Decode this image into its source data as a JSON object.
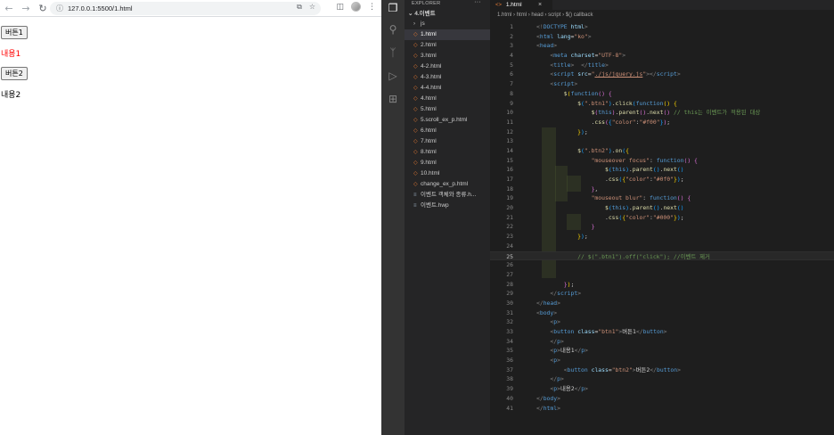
{
  "browser": {
    "url": "127.0.0.1:5500/1.html",
    "page": {
      "button1_label": "버튼1",
      "text1": "내용1",
      "button2_label": "버튼2",
      "text2": "내용2"
    },
    "colors": {
      "text1": "#ff0000",
      "text2": "#000000"
    }
  },
  "vscode": {
    "sidebar": {
      "header": "EXPLORER",
      "more": "···",
      "folder": "4.이벤트",
      "items": [
        {
          "label": "js",
          "type": "folder"
        },
        {
          "label": "1.html",
          "type": "html",
          "selected": true
        },
        {
          "label": "2.html",
          "type": "html"
        },
        {
          "label": "3.html",
          "type": "html"
        },
        {
          "label": "4-2.html",
          "type": "html"
        },
        {
          "label": "4-3.html",
          "type": "html"
        },
        {
          "label": "4-4.html",
          "type": "html"
        },
        {
          "label": "4.html",
          "type": "html"
        },
        {
          "label": "5.html",
          "type": "html"
        },
        {
          "label": "5.scroll_ex_p.html",
          "type": "html"
        },
        {
          "label": "6.html",
          "type": "html"
        },
        {
          "label": "7.html",
          "type": "html"
        },
        {
          "label": "8.html",
          "type": "html"
        },
        {
          "label": "9.html",
          "type": "html"
        },
        {
          "label": "10.html",
          "type": "html"
        },
        {
          "label": "change_ex_p.html",
          "type": "html"
        },
        {
          "label": "이벤트 객체와 종류.h...",
          "type": "doc"
        },
        {
          "label": "이벤트.hwp",
          "type": "doc"
        }
      ]
    },
    "tab": {
      "label": "1.html",
      "close": "×"
    },
    "breadcrumb": [
      "1.html",
      "html",
      "head",
      "script",
      "$() callback"
    ],
    "code_lines": [
      {
        "n": "1",
        "html": "<span class='t-punc'>&lt;!</span><span class='t-tag'>DOCTYPE</span> <span class='t-attr'>html</span><span class='t-punc'>&gt;</span>"
      },
      {
        "n": "2",
        "html": "<span class='t-punc'>&lt;</span><span class='t-tag'>html</span> <span class='t-attr'>lang</span>=<span class='t-str'>\"ko\"</span><span class='t-punc'>&gt;</span>"
      },
      {
        "n": "3",
        "html": "<span class='t-punc'>&lt;</span><span class='t-tag'>head</span><span class='t-punc'>&gt;</span>"
      },
      {
        "n": "4",
        "html": "    <span class='t-punc'>&lt;</span><span class='t-tag'>meta</span> <span class='t-attr'>charset</span>=<span class='t-str'>\"UTF-8\"</span><span class='t-punc'>&gt;</span>"
      },
      {
        "n": "5",
        "html": "    <span class='t-punc'>&lt;</span><span class='t-tag'>title</span><span class='t-punc'>&gt;</span>  <span class='t-punc'>&lt;/</span><span class='t-tag'>title</span><span class='t-punc'>&gt;</span>"
      },
      {
        "n": "6",
        "html": "    <span class='t-punc'>&lt;</span><span class='t-tag'>script</span> <span class='t-attr'>src</span>=<span class='t-str'>\"<u>./js/jquery.js</u>\"</span><span class='t-punc'>&gt;&lt;/</span><span class='t-tag'>script</span><span class='t-punc'>&gt;</span>"
      },
      {
        "n": "7",
        "html": "    <span class='t-punc'>&lt;</span><span class='t-tag'>script</span><span class='t-punc'>&gt;</span>"
      },
      {
        "n": "8",
        "html": "        <span class='t-fn'>$</span><span class='t-br'>(</span><span class='t-kw'>function</span><span class='t-br2'>()</span> <span class='t-br2'>{</span>"
      },
      {
        "n": "9",
        "html": "            <span class='t-fn'>$</span><span class='t-br3'>(</span><span class='t-str'>\".btn1\"</span><span class='t-br3'>)</span>.<span class='t-fn'>click</span><span class='t-br3'>(</span><span class='t-kw'>function</span><span class='t-br'>()</span> <span class='t-br'>{</span>"
      },
      {
        "n": "10",
        "html": "                <span class='t-fn'>$</span><span class='t-br2'>(</span><span class='t-kw'>this</span><span class='t-br2'>)</span>.<span class='t-fn'>parent</span><span class='t-br2'>()</span>.<span class='t-fn'>next</span><span class='t-br2'>()</span> <span class='t-cm'>// this는 이벤트가 적용된 대상</span>"
      },
      {
        "n": "11",
        "html": "                .<span class='t-fn'>css</span><span class='t-br2'>(</span><span class='t-br3'>{</span><span class='t-str'>\"color\"</span>:<span class='t-str'>\"#f00\"</span><span class='t-br3'>}</span><span class='t-br2'>)</span>;"
      },
      {
        "n": "12",
        "html": "            <span class='t-br'>}</span><span class='t-br3'>)</span>;"
      },
      {
        "n": "13",
        "html": ""
      },
      {
        "n": "14",
        "html": "            <span class='t-fn'>$</span><span class='t-br3'>(</span><span class='t-str'>\".btn2\"</span><span class='t-br3'>)</span>.<span class='t-fn'>on</span><span class='t-br3'>(</span><span class='t-br'>{</span>"
      },
      {
        "n": "15",
        "html": "                <span class='t-str'>\"mouseover focus\"</span>: <span class='t-kw'>function</span><span class='t-br2'>()</span> <span class='t-br2'>{</span>"
      },
      {
        "n": "16",
        "html": "                    <span class='t-fn'>$</span><span class='t-br3'>(</span><span class='t-kw'>this</span><span class='t-br3'>)</span>.<span class='t-fn'>parent</span><span class='t-br3'>()</span>.<span class='t-fn'>next</span><span class='t-br3'>()</span>"
      },
      {
        "n": "17",
        "html": "                    .<span class='t-fn'>css</span><span class='t-br3'>(</span><span class='t-br'>{</span><span class='t-str'>\"color\"</span>:<span class='t-str'>\"#0f0\"</span><span class='t-br'>}</span><span class='t-br3'>)</span>;"
      },
      {
        "n": "18",
        "html": "                <span class='t-br2'>}</span>,"
      },
      {
        "n": "19",
        "html": "                <span class='t-str'>\"mouseout blur\"</span>: <span class='t-kw'>function</span><span class='t-br2'>()</span> <span class='t-br2'>{</span>"
      },
      {
        "n": "20",
        "html": "                    <span class='t-fn'>$</span><span class='t-br3'>(</span><span class='t-kw'>this</span><span class='t-br3'>)</span>.<span class='t-fn'>parent</span><span class='t-br3'>()</span>.<span class='t-fn'>next</span><span class='t-br3'>()</span>"
      },
      {
        "n": "21",
        "html": "                    .<span class='t-fn'>css</span><span class='t-br3'>(</span><span class='t-br'>{</span><span class='t-str'>\"color\"</span>:<span class='t-str'>\"#000\"</span><span class='t-br'>}</span><span class='t-br3'>)</span>;"
      },
      {
        "n": "22",
        "html": "                <span class='t-br2'>}</span>"
      },
      {
        "n": "23",
        "html": "            <span class='t-br'>}</span><span class='t-br3'>)</span>;"
      },
      {
        "n": "24",
        "html": ""
      },
      {
        "n": "25",
        "html": "            <span class='t-cm'>// $(\".btn1\").off(\"click\"); //이벤트 제거</span>",
        "current": true
      },
      {
        "n": "26",
        "html": ""
      },
      {
        "n": "27",
        "html": ""
      },
      {
        "n": "28",
        "html": "        <span class='t-br2'>}</span><span class='t-br'>)</span>;"
      },
      {
        "n": "29",
        "html": "    <span class='t-punc'>&lt;/</span><span class='t-tag'>script</span><span class='t-punc'>&gt;</span>"
      },
      {
        "n": "30",
        "html": "<span class='t-punc'>&lt;/</span><span class='t-tag'>head</span><span class='t-punc'>&gt;</span>"
      },
      {
        "n": "31",
        "html": "<span class='t-punc'>&lt;</span><span class='t-tag'>body</span><span class='t-punc'>&gt;</span>"
      },
      {
        "n": "32",
        "html": "    <span class='t-punc'>&lt;</span><span class='t-tag'>p</span><span class='t-punc'>&gt;</span>"
      },
      {
        "n": "33",
        "html": "    <span class='t-punc'>&lt;</span><span class='t-tag'>button</span> <span class='t-attr'>class</span>=<span class='t-str'>\"btn1\"</span><span class='t-punc'>&gt;</span><span class='t-txt'>버튼1</span><span class='t-punc'>&lt;/</span><span class='t-tag'>button</span><span class='t-punc'>&gt;</span>"
      },
      {
        "n": "34",
        "html": "    <span class='t-punc'>&lt;/</span><span class='t-tag'>p</span><span class='t-punc'>&gt;</span>"
      },
      {
        "n": "35",
        "html": "    <span class='t-punc'>&lt;</span><span class='t-tag'>p</span><span class='t-punc'>&gt;</span><span class='t-txt'>내용1</span><span class='t-punc'>&lt;/</span><span class='t-tag'>p</span><span class='t-punc'>&gt;</span>"
      },
      {
        "n": "36",
        "html": "    <span class='t-punc'>&lt;</span><span class='t-tag'>p</span><span class='t-punc'>&gt;</span>"
      },
      {
        "n": "37",
        "html": "        <span class='t-punc'>&lt;</span><span class='t-tag'>button</span> <span class='t-attr'>class</span>=<span class='t-str'>\"btn2\"</span><span class='t-punc'>&gt;</span><span class='t-txt'>버튼2</span><span class='t-punc'>&lt;/</span><span class='t-tag'>button</span><span class='t-punc'>&gt;</span>"
      },
      {
        "n": "38",
        "html": "    <span class='t-punc'>&lt;/</span><span class='t-tag'>p</span><span class='t-punc'>&gt;</span>"
      },
      {
        "n": "39",
        "html": "    <span class='t-punc'>&lt;</span><span class='t-tag'>p</span><span class='t-punc'>&gt;</span><span class='t-txt'>내용2</span><span class='t-punc'>&lt;/</span><span class='t-tag'>p</span><span class='t-punc'>&gt;</span>"
      },
      {
        "n": "40",
        "html": "<span class='t-punc'>&lt;/</span><span class='t-tag'>body</span><span class='t-punc'>&gt;</span>"
      },
      {
        "n": "41",
        "html": "<span class='t-punc'>&lt;/</span><span class='t-tag'>html</span><span class='t-punc'>&gt;</span>"
      }
    ]
  }
}
